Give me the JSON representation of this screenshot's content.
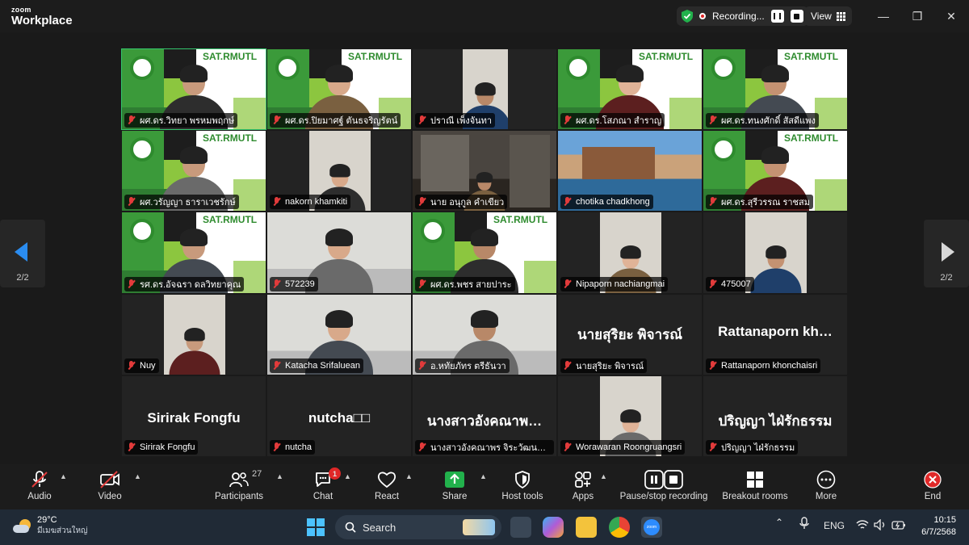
{
  "app": {
    "brand_top": "zoom",
    "brand_bottom": "Workplace",
    "recording_label": "Recording...",
    "view_label": "View"
  },
  "nav": {
    "left_page": "2/2",
    "right_page": "2/2"
  },
  "participants": [
    {
      "name": "ผศ.ดร.วิทยา พรหมพฤกษ์",
      "bg": "sat",
      "active": true
    },
    {
      "name": "ผศ.ดร.ปิยมาศฐ์ ตันธจริญรัตน์",
      "bg": "sat"
    },
    {
      "name": "ปราณี เพ็งจันทา",
      "bg": "portrait"
    },
    {
      "name": "ผศ.ดร.โสภณา สำราญ",
      "bg": "sat"
    },
    {
      "name": "ผศ.ดร.ทนงศักดิ์ สัสดีแพง",
      "bg": "sat"
    },
    {
      "name": "ผศ.วรัญญา ธาราเวชรักษ์",
      "bg": "sat"
    },
    {
      "name": "nakorn khamkiti",
      "bg": "pip"
    },
    {
      "name": "นาย อนุกูล คำเขียว",
      "bg": "room"
    },
    {
      "name": "chotika chadkhong",
      "bg": "resort"
    },
    {
      "name": "ผศ.ดร.สุรีวรรณ ราชสม",
      "bg": "sat"
    },
    {
      "name": "รศ.ดร.อัจฉรา ดลวิทยาคุณ",
      "bg": "sat"
    },
    {
      "name": "572239",
      "bg": "office"
    },
    {
      "name": "ผศ.ดร.พชร สายปาระ",
      "bg": "sat"
    },
    {
      "name": "Nipaporn nachiangmai",
      "bg": "pip"
    },
    {
      "name": "475007",
      "bg": "pip"
    },
    {
      "name": "Nuy",
      "bg": "pip"
    },
    {
      "name": "Katacha Srifaluean",
      "bg": "office"
    },
    {
      "name": "อ.หทัยภัทร ตรีธันวา",
      "bg": "office"
    },
    {
      "name": "นายสุริยะ  พิจารณ์",
      "bg": "text",
      "display": "นายสุริยะ  พิจารณ์"
    },
    {
      "name": "Rattanaporn khonchaisri",
      "bg": "text",
      "display": "Rattanaporn kh…"
    },
    {
      "name": "Sirirak Fongfu",
      "bg": "text",
      "display": "Sirirak Fongfu"
    },
    {
      "name": "nutcha",
      "bg": "text",
      "display": "nutcha□□"
    },
    {
      "name": "นางสาวอังคณาพร จิระวัฒนากูล",
      "bg": "text",
      "display": "นางสาวอังคณาพ…"
    },
    {
      "name": "Worawaran Roongruangsri",
      "bg": "pip"
    },
    {
      "name": "ปริญญา ไฝ่รักธรรม",
      "bg": "text",
      "display": "ปริญญา ไฝ่รักธรรม"
    }
  ],
  "sat_banner": {
    "title": "SAT.RMUTL"
  },
  "toolbar": {
    "audio": "Audio",
    "video": "Video",
    "participants": "Participants",
    "participants_count": "27",
    "chat": "Chat",
    "chat_badge": "1",
    "react": "React",
    "share": "Share",
    "host_tools": "Host tools",
    "apps": "Apps",
    "pause_stop": "Pause/stop recording",
    "breakout": "Breakout rooms",
    "more": "More",
    "end": "End"
  },
  "taskbar": {
    "temperature": "29°C",
    "weather": "มีเมฆส่วนใหญ่",
    "search": "Search",
    "lang": "ENG",
    "time": "10:15",
    "date": "6/7/2568"
  },
  "colors": {
    "accent": "#2a8cf0",
    "active_border": "#33c46c",
    "sat_green": "#2e8b2e",
    "end_red": "#e02828"
  }
}
